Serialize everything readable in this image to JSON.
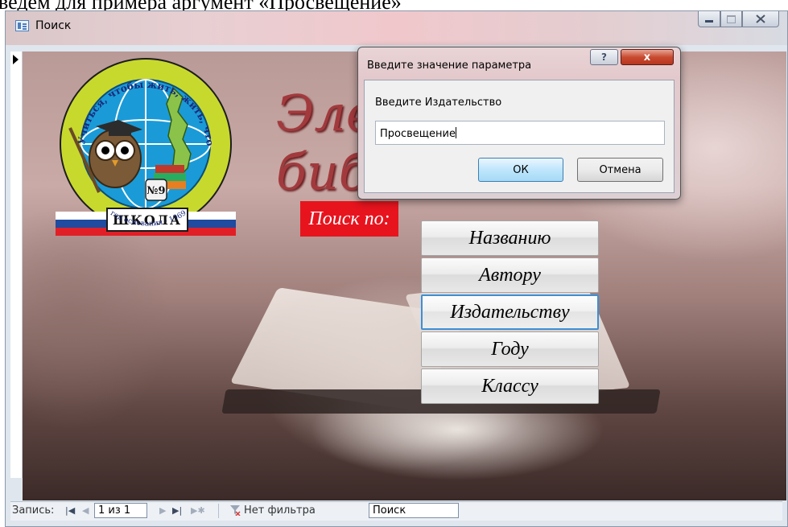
{
  "caption": "ведем для примера аргумент «Просвещение»",
  "window": {
    "title": "Поиск",
    "icon": "form-icon",
    "buttons": [
      "minimize-icon",
      "maximize-icon",
      "close-icon"
    ]
  },
  "form": {
    "background_title": "Электронная библиотека",
    "emblem": {
      "motto": "Учиться, чтобы жить, жить, чтобы учиться!",
      "number": "№9",
      "school_label": "ШКОЛА",
      "founded": "год основания - 1969"
    },
    "search_label": "Поиск по:",
    "buttons": [
      {
        "label": "Названию"
      },
      {
        "label": "Автору"
      },
      {
        "label": "Издательству",
        "focused": true
      },
      {
        "label": "Году"
      },
      {
        "label": "Классу"
      }
    ]
  },
  "navigation": {
    "record_label": "Запись:",
    "record_value": "1 из 1",
    "filter_label": "Нет фильтра",
    "search_value": "Поиск"
  },
  "dialog": {
    "title": "Введите значение параметра",
    "help_glyph": "?",
    "close_glyph": "x",
    "prompt": "Введите Издательство",
    "value": "Просвещение",
    "ok_label": "ОК",
    "cancel_label": "Отмена"
  },
  "colors": {
    "search_label_bg": "#e7141e",
    "script_title": "#a23a3d",
    "emblem_green": "#c8d92e",
    "emblem_blue": "#1a9bd7",
    "focus_border": "#3c8fd6",
    "dialog_close": "#c84b31"
  }
}
